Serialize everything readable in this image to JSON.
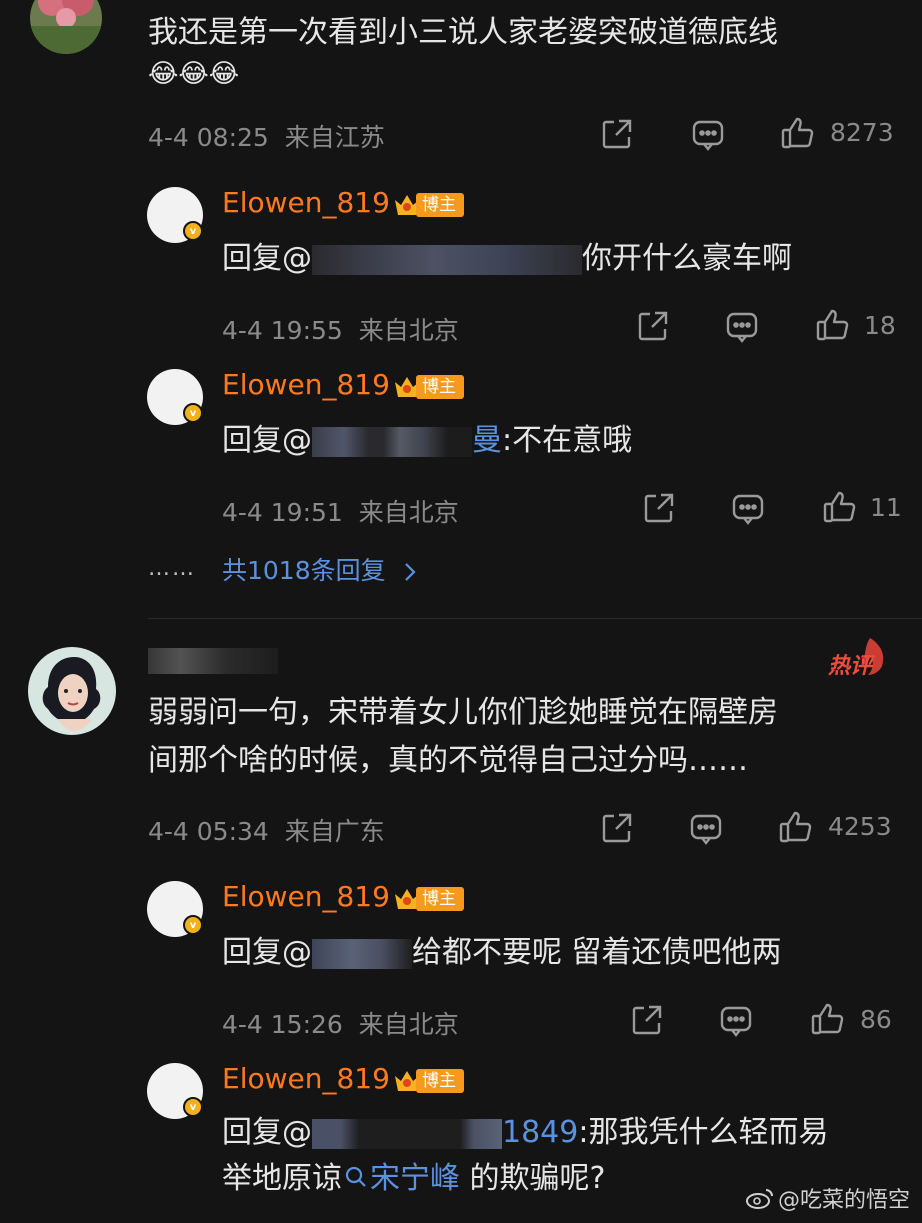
{
  "comment1": {
    "text": "我还是第一次看到小三说人家老婆突破道德底线",
    "emoji": "😂😂😂",
    "time": "4-4 08:25",
    "location": "来自江苏",
    "likes": "8273",
    "replies": [
      {
        "name": "Elowen_819",
        "badge": "博主",
        "prefix": "回复@",
        "suffix": "你开什么豪车啊",
        "time": "4-4 19:55",
        "location": "来自北京",
        "likes": "18"
      },
      {
        "name": "Elowen_819",
        "badge": "博主",
        "prefix": "回复@",
        "mention_tail": "曼",
        "suffix": ":不在意哦",
        "time": "4-4 19:51",
        "location": "来自北京",
        "likes": "11"
      }
    ],
    "more_dots": "……",
    "more_replies": "共1018条回复"
  },
  "comment2": {
    "hot_label": "热评",
    "text_line1": "弱弱问一句，宋带着女儿你们趁她睡觉在隔壁房",
    "text_line2": "间那个啥的时候，真的不觉得自己过分吗……",
    "time": "4-4 05:34",
    "location": "来自广东",
    "likes": "4253",
    "replies": [
      {
        "name": "Elowen_819",
        "badge": "博主",
        "prefix": "回复@",
        "suffix": "给都不要呢 留着还债吧他两",
        "time": "4-4 15:26",
        "location": "来自北京",
        "likes": "86"
      },
      {
        "name": "Elowen_819",
        "badge": "博主",
        "prefix": "回复@",
        "mention_tail": "1849",
        "suffix": ":那我凭什么轻而易",
        "line2_a": "举地原谅",
        "topic": "宋宁峰",
        "line2_b": " 的欺骗呢?"
      }
    ]
  },
  "watermark": "@吃菜的悟空",
  "colors": {
    "background": "#141414",
    "username": "#ff7a1f",
    "link": "#5b92e0",
    "meta": "#8a8a8a",
    "badge": "#f59a1c"
  }
}
